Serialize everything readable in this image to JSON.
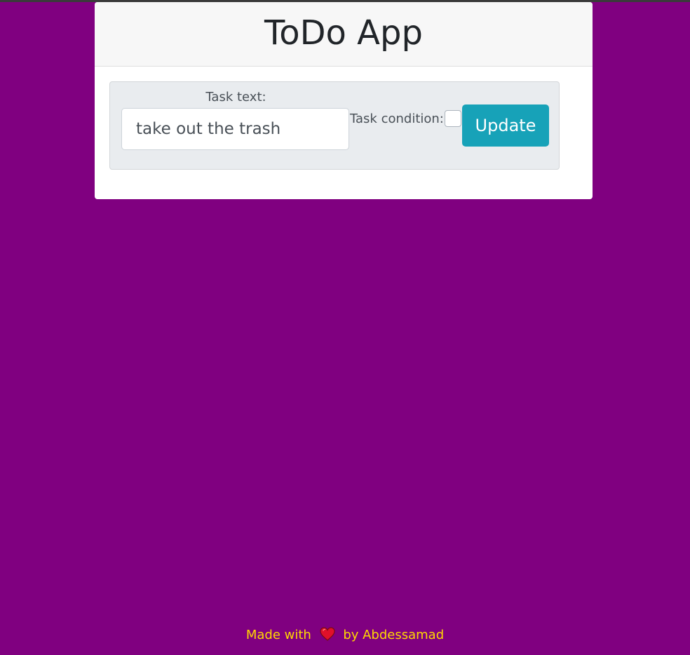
{
  "header": {
    "title": "ToDo App"
  },
  "form": {
    "task_text_label": "Task text:",
    "task_text_value": "take out the trash",
    "task_condition_label": "Task condition:",
    "task_condition_checked": false,
    "update_label": "Update"
  },
  "footer": {
    "made_with": "Made with",
    "by_author": "by Abdessamad",
    "heart_icon": "heart-icon"
  },
  "colors": {
    "background": "#800080",
    "button": "#17a2b8",
    "footer_text": "#ffd700",
    "heart": "#e0102a"
  }
}
